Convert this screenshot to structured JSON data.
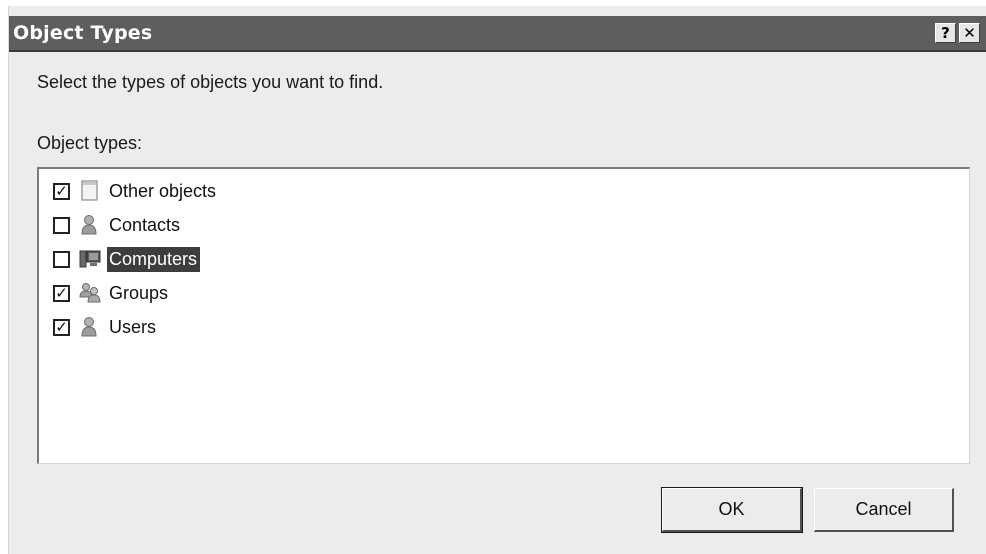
{
  "dialog": {
    "title": "Object Types",
    "help_glyph": "?",
    "close_glyph": "✕",
    "prompt": "Select the types of objects you want to find.",
    "list_label": "Object types:",
    "items": [
      {
        "label": "Other objects",
        "checked": true,
        "icon": "blank-document-icon",
        "selected": false
      },
      {
        "label": "Contacts",
        "checked": false,
        "icon": "contact-person-icon",
        "selected": false
      },
      {
        "label": "Computers",
        "checked": false,
        "icon": "computer-icon",
        "selected": true
      },
      {
        "label": "Groups",
        "checked": true,
        "icon": "group-people-icon",
        "selected": false
      },
      {
        "label": "Users",
        "checked": true,
        "icon": "user-person-icon",
        "selected": false
      }
    ],
    "ok_label": "OK",
    "cancel_label": "Cancel"
  },
  "colors": {
    "titlebar": "#5e5e5e",
    "dialog_bg": "#ececec",
    "selection": "#3d3d3d"
  }
}
